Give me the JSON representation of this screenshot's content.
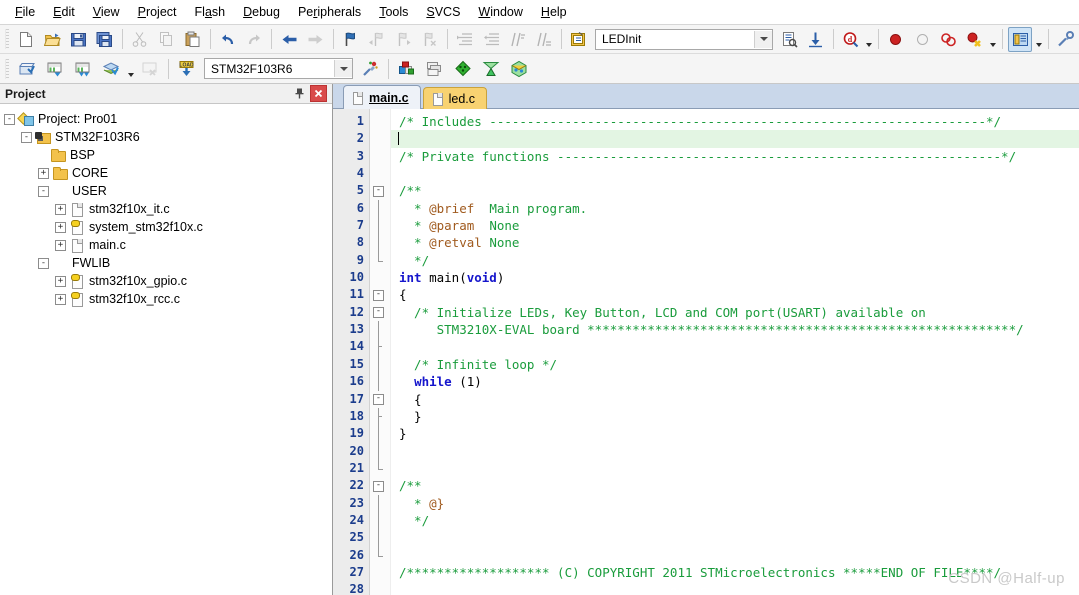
{
  "menu": {
    "items": [
      {
        "label": "File",
        "accel": "F"
      },
      {
        "label": "Edit",
        "accel": "E"
      },
      {
        "label": "View",
        "accel": "V"
      },
      {
        "label": "Project",
        "accel": "P"
      },
      {
        "label": "Flash",
        "accel": "a"
      },
      {
        "label": "Debug",
        "accel": "D"
      },
      {
        "label": "Peripherals",
        "accel": "r"
      },
      {
        "label": "Tools",
        "accel": "T"
      },
      {
        "label": "SVCS",
        "accel": "S"
      },
      {
        "label": "Window",
        "accel": "W"
      },
      {
        "label": "Help",
        "accel": "H"
      }
    ]
  },
  "toolbar1": {
    "buttons": [
      {
        "name": "new-file-icon",
        "title": "New"
      },
      {
        "name": "open-file-icon",
        "title": "Open"
      },
      {
        "name": "save-icon",
        "title": "Save"
      },
      {
        "name": "save-all-icon",
        "title": "Save All"
      },
      {
        "name": "cut-icon",
        "title": "Cut"
      },
      {
        "name": "copy-icon",
        "title": "Copy"
      },
      {
        "name": "paste-icon",
        "title": "Paste"
      },
      {
        "name": "undo-icon",
        "title": "Undo"
      },
      {
        "name": "redo-icon",
        "title": "Redo"
      },
      {
        "name": "navigate-back-icon",
        "title": "Back"
      },
      {
        "name": "navigate-forward-icon",
        "title": "Forward"
      },
      {
        "name": "bookmark-toggle-icon",
        "title": "Insert/Remove Bookmark"
      },
      {
        "name": "bookmark-prev-icon",
        "title": "Previous Bookmark"
      },
      {
        "name": "bookmark-next-icon",
        "title": "Next Bookmark"
      },
      {
        "name": "bookmark-clear-icon",
        "title": "Clear All Bookmarks"
      },
      {
        "name": "indent-icon",
        "title": "Indent"
      },
      {
        "name": "outdent-icon",
        "title": "Outdent"
      },
      {
        "name": "comment-icon",
        "title": "Comment"
      },
      {
        "name": "uncomment-icon",
        "title": "Uncomment"
      },
      {
        "name": "find-in-files-icon",
        "title": "Find in Files"
      }
    ],
    "function_combo_value": "LEDInit",
    "right_buttons": [
      {
        "name": "browse-symbol-icon",
        "title": "Browse Symbol"
      },
      {
        "name": "goto-definition-icon",
        "title": "Go To Definition"
      },
      {
        "name": "start-debug-icon",
        "title": "Start/Stop Debug Session"
      },
      {
        "name": "breakpoint-insert-icon",
        "title": "Insert/Remove Breakpoint"
      },
      {
        "name": "breakpoint-enable-icon",
        "title": "Enable/Disable Breakpoint"
      },
      {
        "name": "breakpoint-disable-all-icon",
        "title": "Disable All Breakpoints"
      },
      {
        "name": "breakpoint-kill-all-icon",
        "title": "Kill All Breakpoints"
      },
      {
        "name": "project-window-icon",
        "title": "Project Window"
      },
      {
        "name": "configuration-wizard-icon",
        "title": "Configuration Wizard"
      }
    ]
  },
  "toolbar2": {
    "buttons": [
      {
        "name": "translate-icon",
        "title": "Translate"
      },
      {
        "name": "build-icon",
        "title": "Build"
      },
      {
        "name": "rebuild-icon",
        "title": "Rebuild"
      },
      {
        "name": "batch-build-icon",
        "title": "Batch Build"
      },
      {
        "name": "stop-build-icon",
        "title": "Stop Build"
      },
      {
        "name": "download-icon",
        "title": "Download"
      }
    ],
    "target_combo_value": "STM32F103R6",
    "right_buttons": [
      {
        "name": "target-options-icon",
        "title": "Options for Target"
      },
      {
        "name": "manage-project-items-icon",
        "title": "Manage Project Items"
      },
      {
        "name": "manage-multi-project-icon",
        "title": "Multi-Project"
      },
      {
        "name": "pack-installer-icon",
        "title": "Pack Installer"
      },
      {
        "name": "run-time-environment-icon",
        "title": "Manage Run-Time Environment"
      },
      {
        "name": "software-packs-icon",
        "title": "Select Software Packs"
      }
    ]
  },
  "project_panel": {
    "title": "Project",
    "pin_title": "Auto Hide",
    "close_title": "Close",
    "tree": [
      {
        "label": "Project: Pro01",
        "depth": 0,
        "toggle": "-",
        "icon": "proj"
      },
      {
        "label": "STM32F103R6",
        "depth": 1,
        "toggle": "-",
        "icon": "target"
      },
      {
        "label": "BSP",
        "depth": 2,
        "toggle": "",
        "icon": "folder"
      },
      {
        "label": "CORE",
        "depth": 2,
        "toggle": "+",
        "icon": "folder"
      },
      {
        "label": "USER",
        "depth": 2,
        "toggle": "-",
        "icon": "folder-open"
      },
      {
        "label": "stm32f10x_it.c",
        "depth": 3,
        "toggle": "+",
        "icon": "doc"
      },
      {
        "label": "system_stm32f10x.c",
        "depth": 3,
        "toggle": "+",
        "icon": "dockey"
      },
      {
        "label": "main.c",
        "depth": 3,
        "toggle": "+",
        "icon": "doc"
      },
      {
        "label": "FWLIB",
        "depth": 2,
        "toggle": "-",
        "icon": "folder-open"
      },
      {
        "label": "stm32f10x_gpio.c",
        "depth": 3,
        "toggle": "+",
        "icon": "dockey"
      },
      {
        "label": "stm32f10x_rcc.c",
        "depth": 3,
        "toggle": "+",
        "icon": "dockey"
      }
    ]
  },
  "editor": {
    "tabs": [
      {
        "label": "main.c",
        "active": true
      },
      {
        "label": "led.c",
        "active": false
      }
    ],
    "cursor_line": 2,
    "lines": [
      {
        "n": 1,
        "fold": "start-open",
        "tokens": [
          {
            "t": "/* Includes ------------------------------------------------------------------*/",
            "c": "cmt"
          }
        ]
      },
      {
        "n": 2,
        "fold": "none",
        "current": true,
        "caret": true,
        "tokens": []
      },
      {
        "n": 3,
        "fold": "none",
        "tokens": [
          {
            "t": "/* Private functions -----------------------------------------------------------*/",
            "c": "cmt"
          }
        ]
      },
      {
        "n": 4,
        "fold": "none",
        "tokens": []
      },
      {
        "n": 5,
        "fold": "box-open",
        "tokens": [
          {
            "t": "/**",
            "c": "cmt"
          }
        ]
      },
      {
        "n": 6,
        "fold": "line",
        "tokens": [
          {
            "t": "  * ",
            "c": "cmt"
          },
          {
            "t": "@brief",
            "c": "tag"
          },
          {
            "t": "  Main program.",
            "c": "cmt"
          }
        ]
      },
      {
        "n": 7,
        "fold": "line",
        "tokens": [
          {
            "t": "  * ",
            "c": "cmt"
          },
          {
            "t": "@param",
            "c": "tag"
          },
          {
            "t": "  None",
            "c": "cmt"
          }
        ]
      },
      {
        "n": 8,
        "fold": "line",
        "tokens": [
          {
            "t": "  * ",
            "c": "cmt"
          },
          {
            "t": "@retval",
            "c": "tag"
          },
          {
            "t": " None",
            "c": "cmt"
          }
        ]
      },
      {
        "n": 9,
        "fold": "end",
        "tokens": [
          {
            "t": "  */",
            "c": "cmt"
          }
        ]
      },
      {
        "n": 10,
        "fold": "none",
        "tokens": [
          {
            "t": "int",
            "c": "kw"
          },
          {
            "t": " main(",
            "c": "plain"
          },
          {
            "t": "void",
            "c": "kw"
          },
          {
            "t": ")",
            "c": "plain"
          }
        ]
      },
      {
        "n": 11,
        "fold": "box-open",
        "tokens": [
          {
            "t": "{",
            "c": "plain"
          }
        ]
      },
      {
        "n": 12,
        "fold": "box-open2",
        "tokens": [
          {
            "t": "  /* Initialize LEDs, Key Button, LCD and COM port(USART) available on",
            "c": "cmt"
          }
        ]
      },
      {
        "n": 13,
        "fold": "line",
        "tokens": [
          {
            "t": "     STM3210X-EVAL board *********************************************************/",
            "c": "cmt"
          }
        ]
      },
      {
        "n": 14,
        "fold": "tick",
        "tokens": []
      },
      {
        "n": 15,
        "fold": "line",
        "tokens": [
          {
            "t": "  /* Infinite loop */",
            "c": "cmt"
          }
        ]
      },
      {
        "n": 16,
        "fold": "line",
        "tokens": [
          {
            "t": "  ",
            "c": "plain"
          },
          {
            "t": "while",
            "c": "kw"
          },
          {
            "t": " (1)",
            "c": "plain"
          }
        ]
      },
      {
        "n": 17,
        "fold": "box-open",
        "tokens": [
          {
            "t": "  {",
            "c": "plain"
          }
        ]
      },
      {
        "n": 18,
        "fold": "tick",
        "tokens": [
          {
            "t": "  }",
            "c": "plain"
          }
        ]
      },
      {
        "n": 19,
        "fold": "line",
        "tokens": [
          {
            "t": "}",
            "c": "plain"
          }
        ]
      },
      {
        "n": 20,
        "fold": "line",
        "tokens": []
      },
      {
        "n": 21,
        "fold": "end",
        "tokens": []
      },
      {
        "n": 22,
        "fold": "box-open",
        "tokens": [
          {
            "t": "/**",
            "c": "cmt"
          }
        ]
      },
      {
        "n": 23,
        "fold": "line",
        "tokens": [
          {
            "t": "  * ",
            "c": "cmt"
          },
          {
            "t": "@}",
            "c": "tag"
          }
        ]
      },
      {
        "n": 24,
        "fold": "line",
        "tokens": [
          {
            "t": "  */",
            "c": "cmt"
          }
        ]
      },
      {
        "n": 25,
        "fold": "line",
        "tokens": []
      },
      {
        "n": 26,
        "fold": "end",
        "tokens": []
      },
      {
        "n": 27,
        "fold": "none",
        "tokens": [
          {
            "t": "/******************* (C) COPYRIGHT 2011 STMicroelectronics *****END OF FILE****/",
            "c": "cmt"
          }
        ]
      },
      {
        "n": 28,
        "fold": "none",
        "tokens": []
      }
    ]
  },
  "watermark": "CSDN @Half-up",
  "colors": {
    "comment": "#1a9c3c",
    "keyword": "#1515cc",
    "doc_tag": "#a05a1e",
    "current_line": "#e3f5e3",
    "line_number": "#1b3c8c",
    "tab_active": "#eef2f8",
    "tab_inactive": "#f8d271",
    "tabstrip": "#c9d7ea"
  }
}
